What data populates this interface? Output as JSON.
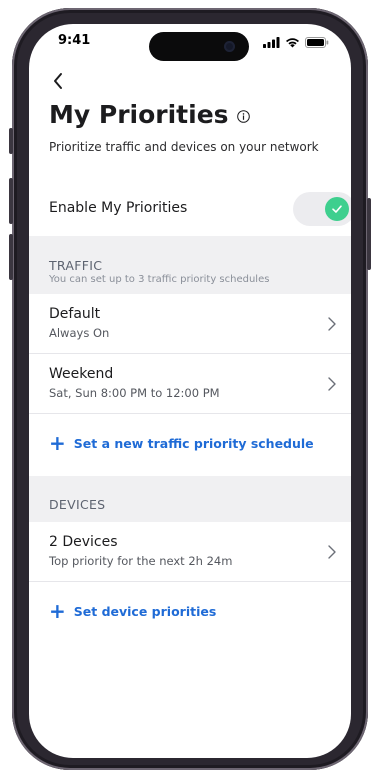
{
  "status_bar": {
    "time": "9:41"
  },
  "header": {
    "title": "My Priorities",
    "subtitle": "Prioritize traffic and devices on your network"
  },
  "enable": {
    "label": "Enable My Priorities",
    "enabled": true,
    "accent": "#3ecf8e"
  },
  "traffic": {
    "title": "TRAFFIC",
    "subtitle": "You can set up to 3 traffic priority schedules",
    "items": [
      {
        "title": "Default",
        "subtitle": "Always On"
      },
      {
        "title": "Weekend",
        "subtitle": "Sat, Sun 8:00 PM to 12:00 PM"
      }
    ],
    "add_label": "Set a new traffic priority schedule"
  },
  "devices": {
    "title": "DEVICES",
    "items": [
      {
        "title": "2 Devices",
        "subtitle": "Top priority for the next 2h 24m"
      }
    ],
    "add_label": "Set device priorities"
  },
  "colors": {
    "link": "#1f6bd6",
    "section_bg": "#f0f0f2"
  }
}
